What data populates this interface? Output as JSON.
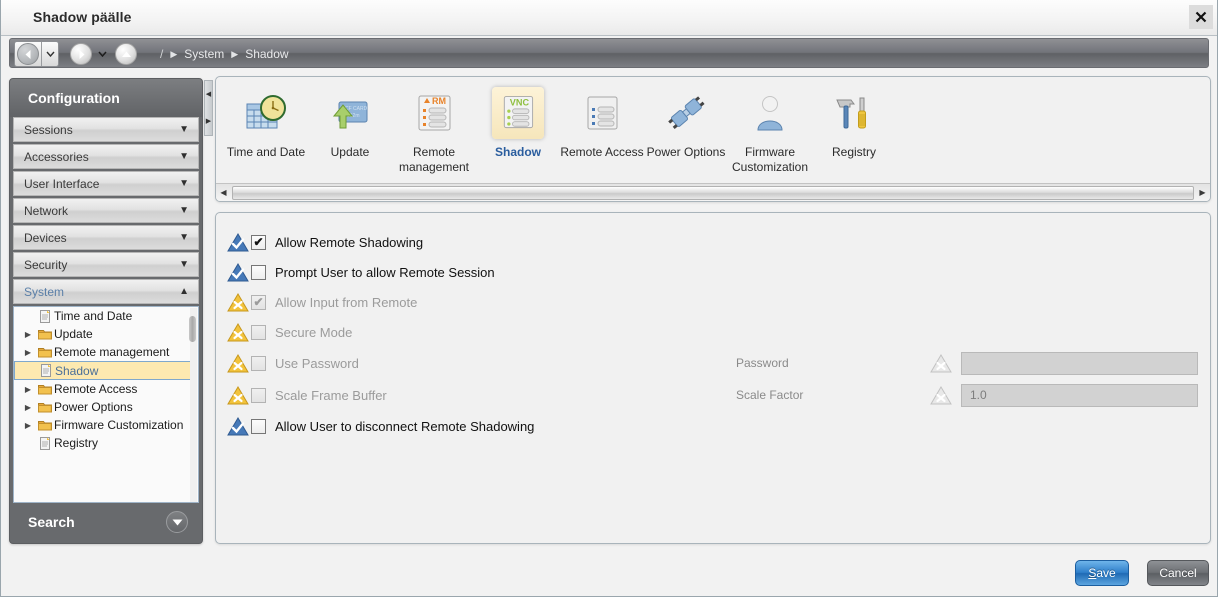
{
  "window": {
    "title": "Shadow päälle",
    "close_icon": "close-icon"
  },
  "navbar": {
    "back_icon": "back-arrow-icon",
    "back_dropdown_icon": "chevron-down-icon",
    "forward_icon": "forward-arrow-icon",
    "forward_dropdown_icon": "chevron-down-icon",
    "up_icon": "up-arrow-icon",
    "breadcrumb": {
      "root": "/",
      "items": [
        "System",
        "Shadow"
      ],
      "separator_icon": "breadcrumb-arrow-icon"
    }
  },
  "sidebar": {
    "header": "Configuration",
    "groups": [
      {
        "label": "Sessions",
        "expanded": false,
        "caret": "▼"
      },
      {
        "label": "Accessories",
        "expanded": false,
        "caret": "▼"
      },
      {
        "label": "User Interface",
        "expanded": false,
        "caret": "▼"
      },
      {
        "label": "Network",
        "expanded": false,
        "caret": "▼"
      },
      {
        "label": "Devices",
        "expanded": false,
        "caret": "▼"
      },
      {
        "label": "Security",
        "expanded": false,
        "caret": "▼"
      },
      {
        "label": "System",
        "expanded": true,
        "caret": "▲"
      }
    ],
    "tree": [
      {
        "label": "Time and Date",
        "icon": "document-icon",
        "expandable": false,
        "selected": false
      },
      {
        "label": "Update",
        "icon": "folder-icon",
        "expandable": true,
        "selected": false
      },
      {
        "label": "Remote management",
        "icon": "folder-icon",
        "expandable": true,
        "selected": false
      },
      {
        "label": "Shadow",
        "icon": "document-icon",
        "expandable": false,
        "selected": true
      },
      {
        "label": "Remote Access",
        "icon": "folder-icon",
        "expandable": true,
        "selected": false
      },
      {
        "label": "Power Options",
        "icon": "folder-icon",
        "expandable": true,
        "selected": false
      },
      {
        "label": "Firmware Customization",
        "icon": "folder-icon",
        "expandable": true,
        "selected": false
      },
      {
        "label": "Registry",
        "icon": "document-icon",
        "expandable": false,
        "selected": false
      }
    ],
    "search": {
      "label": "Search",
      "caret": "▼"
    },
    "collapse_handle_icon": "sidebar-collapse-icon"
  },
  "toolbar": {
    "items": [
      {
        "label": "Time and Date",
        "icon": "calendar-clock-icon",
        "selected": false
      },
      {
        "label": "Update",
        "icon": "cf-card-upload-icon",
        "selected": false
      },
      {
        "label": "Remote management",
        "icon": "rm-document-icon",
        "selected": false
      },
      {
        "label": "Shadow",
        "icon": "vnc-document-icon",
        "selected": true
      },
      {
        "label": "Remote Access",
        "icon": "list-document-icon",
        "selected": false
      },
      {
        "label": "Power Options",
        "icon": "power-plugs-icon",
        "selected": false
      },
      {
        "label": "Firmware Customization",
        "icon": "user-person-icon",
        "selected": false
      },
      {
        "label": "Registry",
        "icon": "hammer-screwdriver-icon",
        "selected": false
      }
    ],
    "scroll_left_icon": "scroll-left-icon",
    "scroll_right_icon": "scroll-right-icon"
  },
  "settings": {
    "rows": [
      {
        "label": "Allow Remote Shadowing",
        "checked": true,
        "enabled": true,
        "status": "ok",
        "mark": "✔"
      },
      {
        "label": "Prompt User to allow Remote Session",
        "checked": false,
        "enabled": true,
        "status": "ok",
        "mark": ""
      },
      {
        "label": "Allow Input from Remote",
        "checked": true,
        "enabled": false,
        "status": "warning",
        "mark": "✔"
      },
      {
        "label": "Secure Mode",
        "checked": false,
        "enabled": false,
        "status": "warning",
        "mark": ""
      },
      {
        "label": "Use Password",
        "checked": false,
        "enabled": false,
        "status": "warning",
        "mark": ""
      },
      {
        "label": "Scale Frame Buffer",
        "checked": false,
        "enabled": false,
        "status": "warning",
        "mark": ""
      },
      {
        "label": "Allow User to disconnect Remote Shadowing",
        "checked": false,
        "enabled": true,
        "status": "ok",
        "mark": ""
      }
    ],
    "fields": [
      {
        "label": "Password",
        "value": "",
        "placeholder": "",
        "enabled": false,
        "status": "disabled",
        "row": 4
      },
      {
        "label": "Scale Factor",
        "value": "1.0",
        "placeholder": "",
        "enabled": false,
        "status": "disabled",
        "row": 5
      }
    ]
  },
  "footer": {
    "save": {
      "accel": "S",
      "rest": "ave"
    },
    "cancel": "Cancel"
  },
  "colors": {
    "accent_blue": "#2a5d9e",
    "selection_yellow": "#fde9b0",
    "status_ok": "#3a6fb5",
    "status_warning": "#f0b429",
    "save_button": "#2f7fca"
  }
}
